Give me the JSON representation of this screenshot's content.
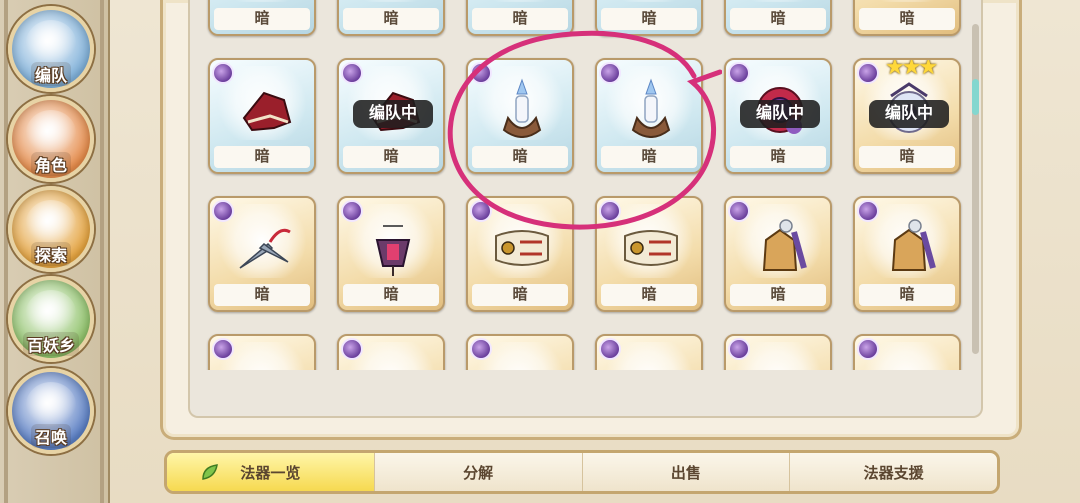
{
  "sidebar": {
    "items": [
      {
        "label": "编队",
        "icon": "team-icon",
        "color": "#7fb0d9"
      },
      {
        "label": "角色",
        "icon": "character-icon",
        "color": "#e58b4a"
      },
      {
        "label": "探索",
        "icon": "explore-icon",
        "color": "#e4a33f"
      },
      {
        "label": "百妖乡",
        "icon": "village-icon",
        "color": "#8fc26a"
      },
      {
        "label": "召唤",
        "icon": "summon-icon",
        "color": "#5b7fc4"
      }
    ]
  },
  "grid": {
    "rows": [
      {
        "items": [
          {
            "label": "暗",
            "frame": "blue",
            "art": "red-hat-icon"
          },
          {
            "label": "暗",
            "frame": "blue",
            "art": "red-hat-icon"
          },
          {
            "label": "暗",
            "frame": "blue",
            "art": "candle-icon"
          },
          {
            "label": "暗",
            "frame": "blue",
            "art": "candle-icon"
          },
          {
            "label": "暗",
            "frame": "blue",
            "art": "mirror-icon"
          },
          {
            "label": "暗",
            "frame": "gold",
            "art": "orb-icon"
          }
        ]
      },
      {
        "items": [
          {
            "label": "暗",
            "frame": "blue",
            "art": "red-hat-icon"
          },
          {
            "label": "暗",
            "frame": "blue",
            "art": "red-hat-icon",
            "badge": "编队中"
          },
          {
            "label": "暗",
            "frame": "blue",
            "art": "candle-icon"
          },
          {
            "label": "暗",
            "frame": "blue",
            "art": "candle-icon"
          },
          {
            "label": "暗",
            "frame": "blue",
            "art": "mirror-icon",
            "badge": "编队中"
          },
          {
            "label": "暗",
            "frame": "gold",
            "art": "orb-icon",
            "badge": "编队中",
            "stars": 3
          }
        ]
      },
      {
        "items": [
          {
            "label": "暗",
            "frame": "gold",
            "art": "kunai-icon"
          },
          {
            "label": "暗",
            "frame": "gold",
            "art": "lantern-icon"
          },
          {
            "label": "暗",
            "frame": "gold",
            "art": "fish-banner-icon"
          },
          {
            "label": "暗",
            "frame": "gold",
            "art": "fish-banner-icon"
          },
          {
            "label": "暗",
            "frame": "gold",
            "art": "shogi-piece-icon"
          },
          {
            "label": "暗",
            "frame": "gold",
            "art": "shogi-piece-icon"
          }
        ]
      },
      {
        "items": [
          {
            "label": "",
            "frame": "gold",
            "art": "charm-icon"
          },
          {
            "label": "",
            "frame": "gold",
            "art": "claw-icon"
          },
          {
            "label": "",
            "frame": "gold",
            "art": "claw-icon"
          },
          {
            "label": "",
            "frame": "gold",
            "art": "charm-icon"
          },
          {
            "label": "",
            "frame": "gold",
            "art": "claw-icon"
          },
          {
            "label": "",
            "frame": "gold",
            "art": "claw-icon"
          }
        ]
      }
    ]
  },
  "tabs": [
    {
      "label": "法器一览",
      "active": true,
      "icon": "leaf-icon"
    },
    {
      "label": "分解",
      "active": false
    },
    {
      "label": "出售",
      "active": false
    },
    {
      "label": "法器支援",
      "active": false
    }
  ],
  "colors": {
    "annotation": "#d6307a",
    "active_tab": "#f6d950",
    "element_dark": "#6b3f9c"
  }
}
